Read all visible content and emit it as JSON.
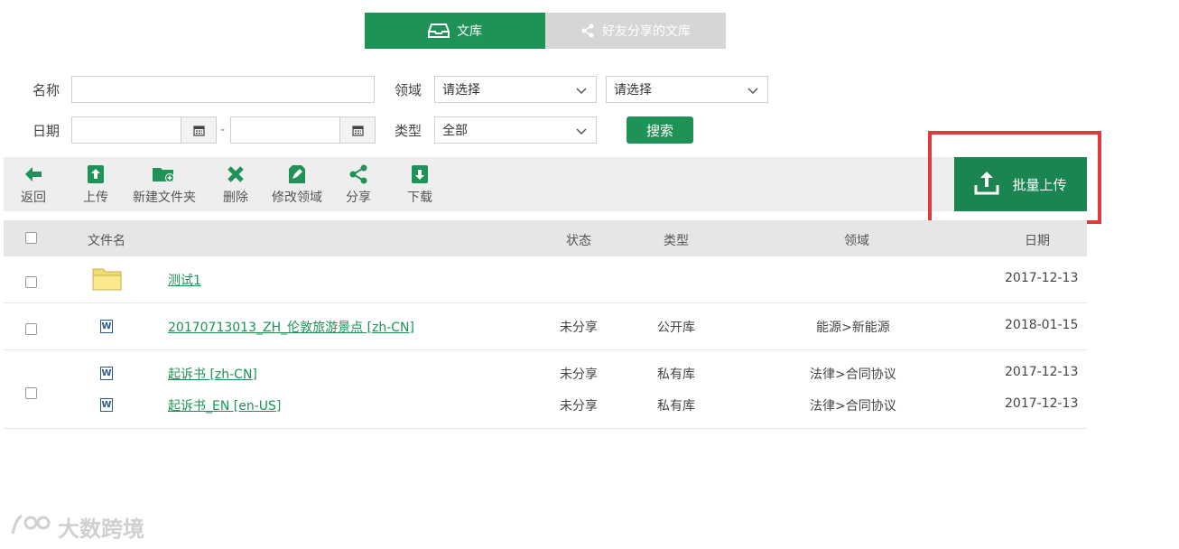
{
  "tabs": [
    {
      "label": "文库",
      "icon": "inbox-icon",
      "active": true
    },
    {
      "label": "好友分享的文库",
      "icon": "share-icon",
      "active": false
    }
  ],
  "filters": {
    "name_label": "名称",
    "name_value": "",
    "domain_label": "领域",
    "domain_select1": "请选择",
    "domain_select2": "请选择",
    "date_label": "日期",
    "date_from": "",
    "date_to": "",
    "date_separator": "-",
    "type_label": "类型",
    "type_select": "全部",
    "search_label": "搜索"
  },
  "toolbar": [
    {
      "label": "返回",
      "icon": "arrow-left-icon"
    },
    {
      "label": "上传",
      "icon": "upload-icon"
    },
    {
      "label": "新建文件夹",
      "icon": "new-folder-icon"
    },
    {
      "label": "删除",
      "icon": "delete-icon"
    },
    {
      "label": "修改领域",
      "icon": "edit-icon"
    },
    {
      "label": "分享",
      "icon": "share-icon"
    },
    {
      "label": "下载",
      "icon": "download-icon"
    }
  ],
  "batch_upload": {
    "label": "批量上传",
    "icon": "upload-tray-icon"
  },
  "table": {
    "headers": {
      "name": "文件名",
      "status": "状态",
      "type": "类型",
      "domain": "领域",
      "date": "日期"
    },
    "rows": [
      {
        "kind": "folder",
        "name": "测试1",
        "status": "",
        "type": "",
        "domain": "",
        "date": "2017-12-13"
      },
      {
        "kind": "doc",
        "name": "20170713013_ZH_伦敦旅游景点 [zh-CN]",
        "status": "未分享",
        "type": "公开库",
        "domain": "能源>新能源",
        "date": "2018-01-15"
      }
    ],
    "group": [
      {
        "kind": "doc",
        "name": "起诉书 [zh-CN]",
        "status": "未分享",
        "type": "私有库",
        "domain": "法律>合同协议",
        "date": "2017-12-13"
      },
      {
        "kind": "doc",
        "name": "起诉书_EN [en-US]",
        "status": "未分享",
        "type": "私有库",
        "domain": "法律>合同协议",
        "date": "2017-12-13"
      }
    ]
  },
  "colors": {
    "accent": "#1e9257",
    "highlight": "#e2393b"
  },
  "watermark": "大数跨境"
}
